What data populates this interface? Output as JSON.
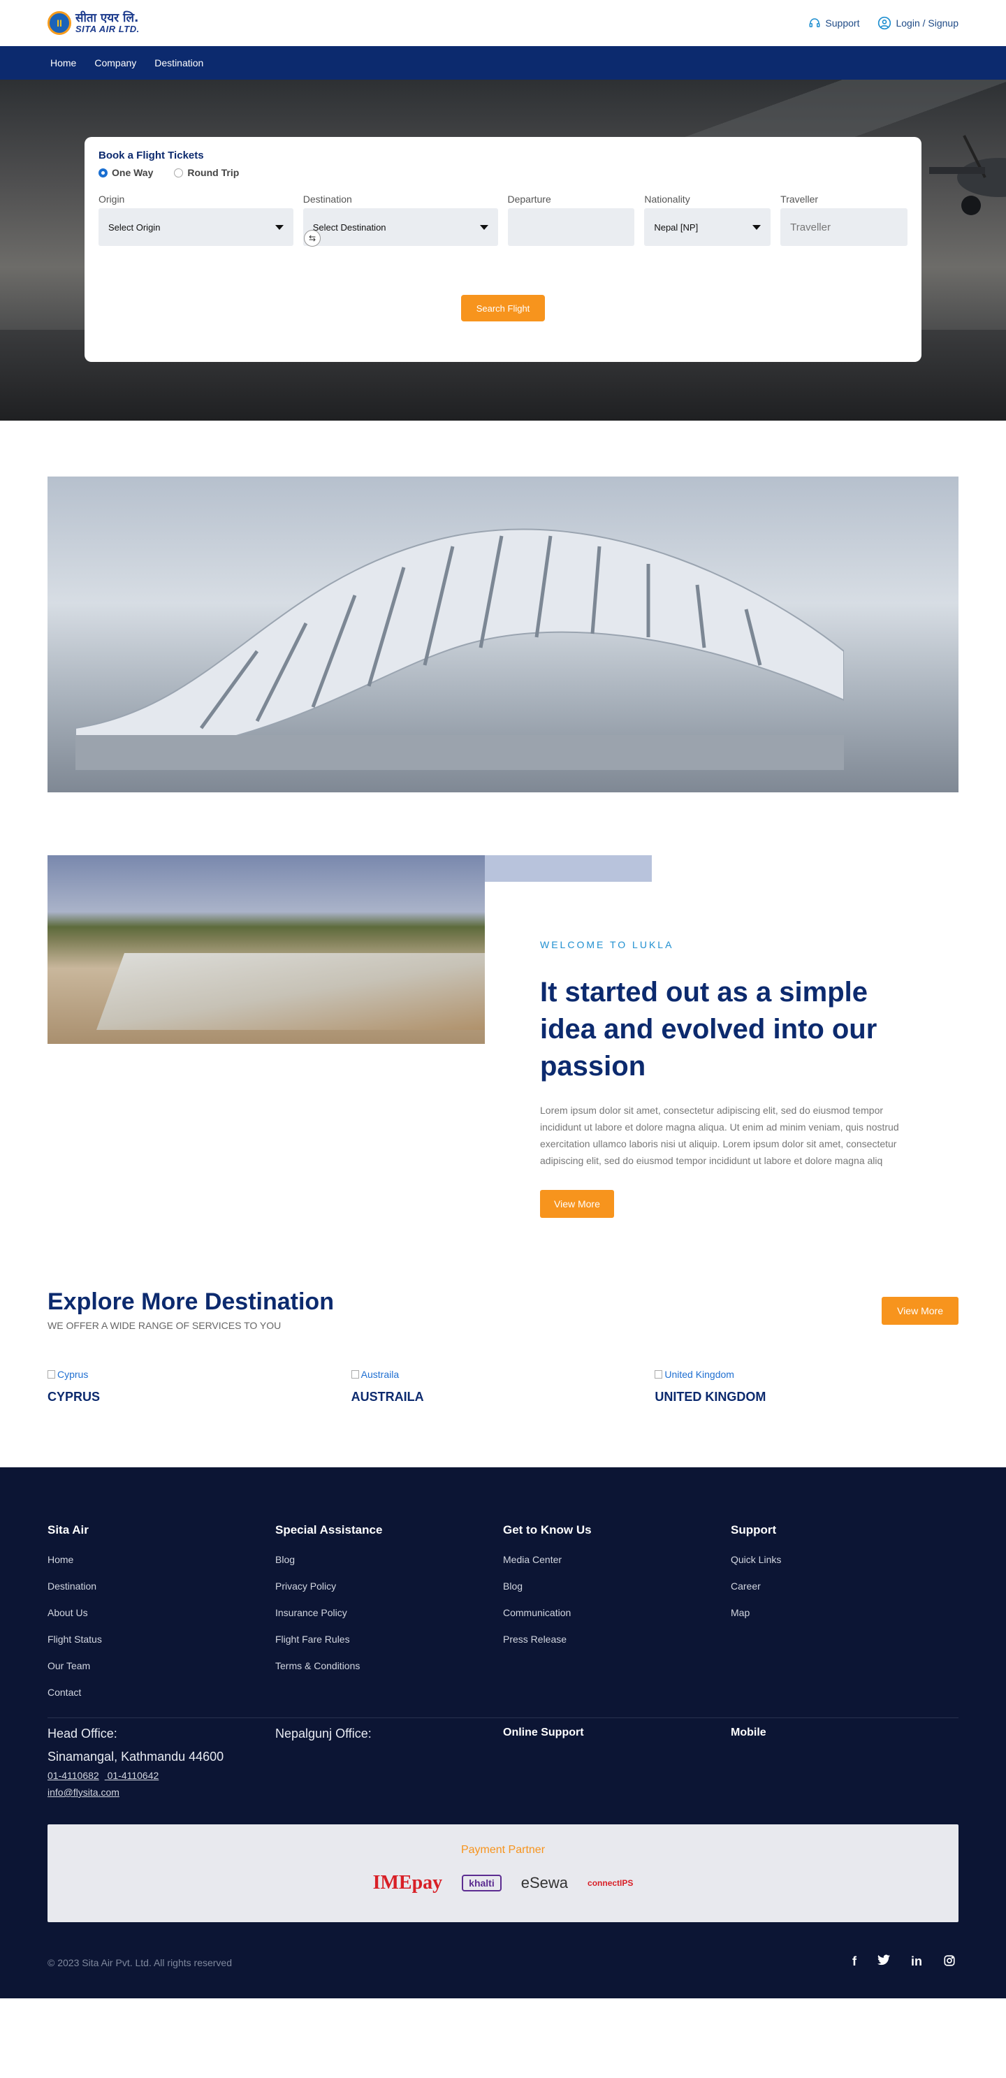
{
  "topbar": {
    "logo_native": "सीता एयर लि.",
    "logo_latin": "SITA AIR LTD.",
    "support_label": "Support",
    "login_label": "Login / Signup"
  },
  "nav": {
    "items": [
      {
        "label": "Home"
      },
      {
        "label": "Company"
      },
      {
        "label": "Destination"
      }
    ]
  },
  "booking": {
    "title": "Book a Flight Tickets",
    "trip_types": [
      {
        "label": "One Way",
        "selected": true
      },
      {
        "label": "Round Trip",
        "selected": false
      }
    ],
    "fields": {
      "origin": {
        "label": "Origin",
        "value": "Select Origin"
      },
      "destination": {
        "label": "Destination",
        "value": "Select Destination"
      },
      "departure": {
        "label": "Departure",
        "value": ""
      },
      "nationality": {
        "label": "Nationality",
        "value": "Nepal [NP]"
      },
      "traveller": {
        "label": "Traveller",
        "placeholder": "Traveller"
      }
    },
    "search_label": "Search Flight"
  },
  "welcome": {
    "eyebrow": "WELCOME TO LUKLA",
    "heading": "It started out as a simple idea and evolved into our passion",
    "body": "Lorem ipsum dolor sit amet, consectetur adipiscing elit, sed do eiusmod tempor incididunt ut labore et dolore magna aliqua. Ut enim ad minim veniam, quis nostrud exercitation ullamco laboris nisi ut aliquip. Lorem ipsum dolor sit amet, consectetur adipiscing elit, sed do eiusmod tempor incididunt ut labore et dolore magna aliq",
    "button_label": "View More"
  },
  "destinations": {
    "title": "Explore More Destination",
    "subtitle": "WE OFFER A WIDE RANGE OF SERVICES TO YOU",
    "button_label": "View More",
    "cards": [
      {
        "alt": "Cyprus",
        "name": "CYPRUS"
      },
      {
        "alt": "Austraila",
        "name": "AUSTRAILA"
      },
      {
        "alt": "United Kingdom",
        "name": "UNITED KINGDOM"
      }
    ]
  },
  "footer": {
    "columns": [
      {
        "heading": "Sita Air",
        "links": [
          "Home",
          "Destination",
          "About Us",
          "Flight Status",
          "Our Team",
          "Contact"
        ]
      },
      {
        "heading": "Special Assistance",
        "links": [
          "Blog",
          "Privacy Policy",
          "Insurance Policy",
          "Flight Fare Rules",
          "Terms & Conditions"
        ]
      },
      {
        "heading": "Get to Know Us",
        "links": [
          "Media Center",
          "Blog",
          "Communication",
          "Press Release"
        ]
      },
      {
        "heading": "Support",
        "links": [
          "Quick Links",
          "Career",
          "Map"
        ]
      }
    ],
    "head_office": {
      "heading": "Head Office:",
      "address": "Sinamangal, Kathmandu 44600",
      "phone_1": "01-4110682",
      "phone_2": "01-4110642",
      "email": "info@flysita.com"
    },
    "nepalgunj_office": {
      "heading": "Nepalgunj Office:"
    },
    "online_support": "Online Support",
    "mobile": "Mobile",
    "payment": {
      "title": "Payment Partner",
      "partners": [
        "IMEpay",
        "khalti",
        "eSewa",
        "connectIPS"
      ]
    },
    "copyright": "© 2023 Sita Air Pvt. Ltd. All rights reserved",
    "socials": [
      "facebook-icon",
      "twitter-icon",
      "linkedin-icon",
      "instagram-icon"
    ]
  },
  "colors": {
    "navy": "#0c2a6e",
    "orange": "#f7941d",
    "footer_bg": "#0c1534",
    "accent_blue": "#1f8fd0"
  }
}
